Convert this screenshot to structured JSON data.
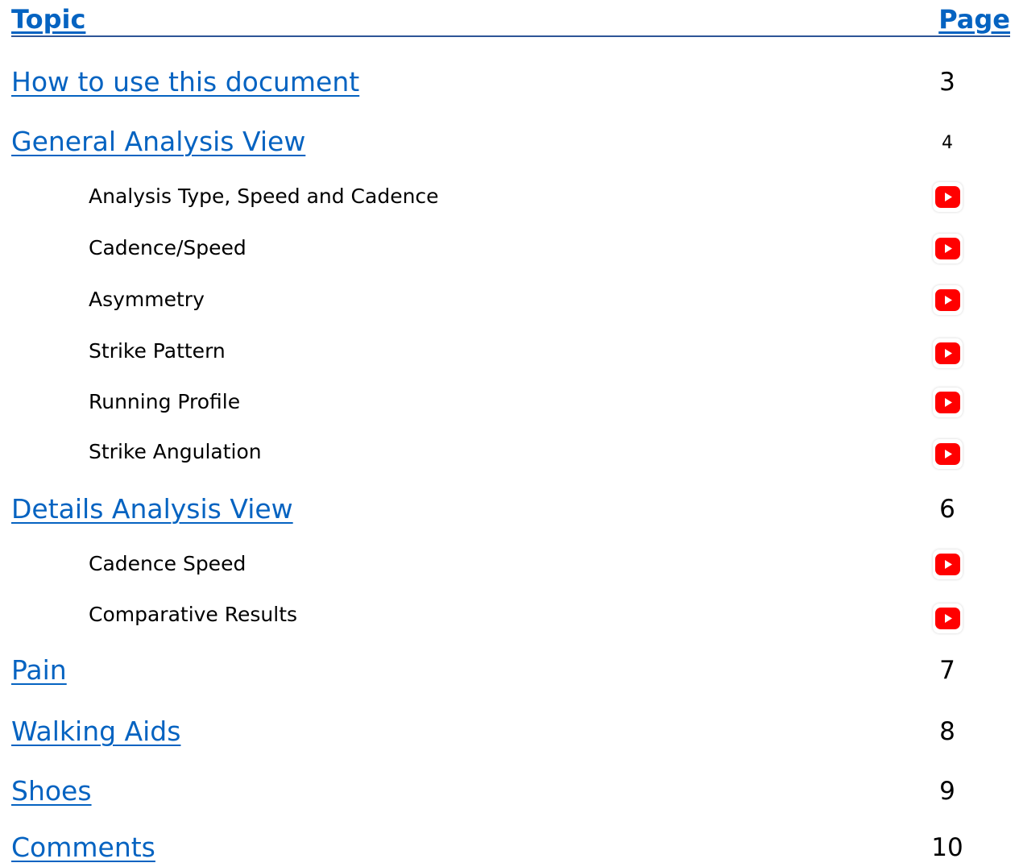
{
  "header": {
    "topic_label": "Topic",
    "page_label": "Page"
  },
  "toc": {
    "how_to_use": {
      "label": "How to use this document",
      "page": "3"
    },
    "general_analysis": {
      "label": "General Analysis View",
      "page": "4",
      "subs": [
        {
          "label": "Analysis Type, Speed and Cadence",
          "icon": "youtube-play-icon"
        },
        {
          "label": "Cadence/Speed",
          "icon": "youtube-play-icon"
        },
        {
          "label": "Asymmetry",
          "icon": "youtube-play-icon"
        },
        {
          "label": "Strike Pattern",
          "icon": "youtube-play-icon"
        },
        {
          "label": "Running Profile",
          "icon": "youtube-play-icon"
        },
        {
          "label": "Strike Angulation",
          "icon": "youtube-play-icon"
        }
      ]
    },
    "details_analysis": {
      "label": "Details Analysis View",
      "page": "6",
      "subs": [
        {
          "label": "Cadence Speed",
          "icon": "youtube-play-icon"
        },
        {
          "label": "Comparative Results",
          "icon": "youtube-play-icon"
        }
      ]
    },
    "pain": {
      "label": "Pain",
      "page": "7"
    },
    "walking_aids": {
      "label": "Walking Aids",
      "page": "8"
    },
    "shoes": {
      "label": "Shoes",
      "page": "9"
    },
    "comments": {
      "label": "Comments",
      "page": "10"
    }
  },
  "colors": {
    "link": "#0563c1",
    "header_rule": "#2e5597",
    "youtube_red": "#ff0000"
  }
}
